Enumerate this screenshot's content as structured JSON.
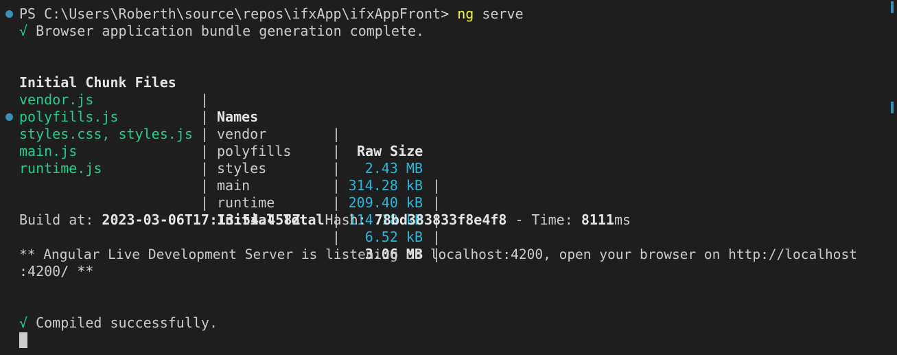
{
  "prompt": {
    "ps": "PS C:\\Users\\Roberth\\source\\repos\\ifxApp\\ifxAppFront>",
    "cmd_ng": "ng",
    "cmd_arg": "serve"
  },
  "bundle_status": {
    "check": "√",
    "text": "Browser application bundle generation complete."
  },
  "table": {
    "headers": [
      "Initial Chunk Files",
      "Names",
      "Raw Size"
    ],
    "rows": [
      {
        "file": "vendor.js",
        "name": "vendor",
        "size": "2.43 MB"
      },
      {
        "file": "polyfills.js",
        "name": "polyfills",
        "size": "314.28 kB"
      },
      {
        "file": "styles.css, styles.js",
        "name": "styles",
        "size": "209.40 kB"
      },
      {
        "file": "main.js",
        "name": "main",
        "size": "114.18 kB"
      },
      {
        "file": "runtime.js",
        "name": "runtime",
        "size": "6.52 kB"
      }
    ],
    "total_label": "Initial Total",
    "total_value": "3.06 MB",
    "separator": "|"
  },
  "build": {
    "build_at_label": "Build at: ",
    "build_at_value": "2023-03-06T17:13:54.458Z",
    "hash_label": " - Hash: ",
    "hash_value": "78bd383833f8e4f8",
    "time_label": " - Time: ",
    "time_value": "8111",
    "time_unit": "ms"
  },
  "server": {
    "line1": "** Angular Live Development Server is listening on localhost:4200, open your browser on http://localhost",
    "line2": ":4200/ **"
  },
  "compiled": {
    "check": "√",
    "text": "Compiled successfully."
  },
  "colors": {
    "background": "#1e1e1e",
    "text": "#cccccc",
    "green": "#23d18b",
    "cyan": "#29b8db",
    "yellow": "#f5f543",
    "decoration": "#3a8fb7"
  }
}
